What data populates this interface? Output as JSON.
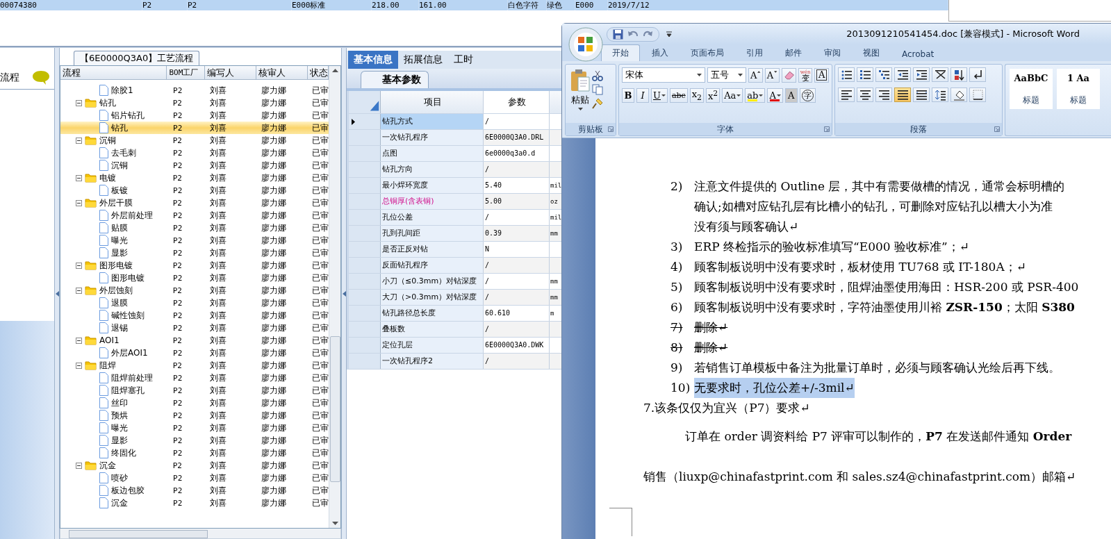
{
  "order_row": {
    "selected": true,
    "cells": [
      "00074380",
      "P2",
      "P2",
      "E000标准",
      "218.00",
      "161.00",
      "白色字符",
      "绿色",
      "E000",
      "2019/7/12"
    ]
  },
  "sidebar": {
    "title": "流程"
  },
  "process_panel": {
    "title": "【6E0000Q3A0】工艺流程",
    "columns": [
      "流程",
      "BOM工厂",
      "编写人",
      "核审人",
      "状态"
    ],
    "items": [
      {
        "name": "除胶1",
        "bom": "P2",
        "writer": "刘喜",
        "reviewer": "廖力娜",
        "status": "已审",
        "selected": false
      },
      {
        "name": "钻孔",
        "bom": "P2",
        "writer": "刘喜",
        "reviewer": "廖力娜",
        "status": "已审",
        "selected": false,
        "expanded": true,
        "children": [
          {
            "name": "铝片钻孔",
            "bom": "P2",
            "writer": "刘喜",
            "reviewer": "廖力娜",
            "status": "已审",
            "selected": false
          },
          {
            "name": "钻孔",
            "bom": "P2",
            "writer": "刘喜",
            "reviewer": "廖力娜",
            "status": "已审",
            "selected": true
          }
        ]
      },
      {
        "name": "沉铜",
        "bom": "P2",
        "writer": "刘喜",
        "reviewer": "廖力娜",
        "status": "已审",
        "selected": false,
        "expanded": true,
        "children": [
          {
            "name": "去毛刺",
            "bom": "P2",
            "writer": "刘喜",
            "reviewer": "廖力娜",
            "status": "已审",
            "selected": false
          },
          {
            "name": "沉铜",
            "bom": "P2",
            "writer": "刘喜",
            "reviewer": "廖力娜",
            "status": "已审",
            "selected": false
          }
        ]
      },
      {
        "name": "电镀",
        "bom": "P2",
        "writer": "刘喜",
        "reviewer": "廖力娜",
        "status": "已审",
        "selected": false,
        "expanded": true,
        "children": [
          {
            "name": "板镀",
            "bom": "P2",
            "writer": "刘喜",
            "reviewer": "廖力娜",
            "status": "已审",
            "selected": false
          }
        ]
      },
      {
        "name": "外层干膜",
        "bom": "P2",
        "writer": "刘喜",
        "reviewer": "廖力娜",
        "status": "已审",
        "selected": false,
        "expanded": true,
        "children": [
          {
            "name": "外层前处理",
            "bom": "P2",
            "writer": "刘喜",
            "reviewer": "廖力娜",
            "status": "已审",
            "selected": false
          },
          {
            "name": "贴膜",
            "bom": "P2",
            "writer": "刘喜",
            "reviewer": "廖力娜",
            "status": "已审",
            "selected": false
          },
          {
            "name": "曝光",
            "bom": "P2",
            "writer": "刘喜",
            "reviewer": "廖力娜",
            "status": "已审",
            "selected": false
          },
          {
            "name": "显影",
            "bom": "P2",
            "writer": "刘喜",
            "reviewer": "廖力娜",
            "status": "已审",
            "selected": false
          }
        ]
      },
      {
        "name": "图形电镀",
        "bom": "P2",
        "writer": "刘喜",
        "reviewer": "廖力娜",
        "status": "已审",
        "selected": false,
        "expanded": true,
        "children": [
          {
            "name": "图形电镀",
            "bom": "P2",
            "writer": "刘喜",
            "reviewer": "廖力娜",
            "status": "已审",
            "selected": false
          }
        ]
      },
      {
        "name": "外层蚀刻",
        "bom": "P2",
        "writer": "刘喜",
        "reviewer": "廖力娜",
        "status": "已审",
        "selected": false,
        "expanded": true,
        "children": [
          {
            "name": "退膜",
            "bom": "P2",
            "writer": "刘喜",
            "reviewer": "廖力娜",
            "status": "已审",
            "selected": false
          },
          {
            "name": "碱性蚀刻",
            "bom": "P2",
            "writer": "刘喜",
            "reviewer": "廖力娜",
            "status": "已审",
            "selected": false
          },
          {
            "name": "退锡",
            "bom": "P2",
            "writer": "刘喜",
            "reviewer": "廖力娜",
            "status": "已审",
            "selected": false
          }
        ]
      },
      {
        "name": "AOI1",
        "bom": "P2",
        "writer": "刘喜",
        "reviewer": "廖力娜",
        "status": "已审",
        "selected": false,
        "expanded": true,
        "children": [
          {
            "name": "外层AOI1",
            "bom": "P2",
            "writer": "刘喜",
            "reviewer": "廖力娜",
            "status": "已审",
            "selected": false
          }
        ]
      },
      {
        "name": "阻焊",
        "bom": "P2",
        "writer": "刘喜",
        "reviewer": "廖力娜",
        "status": "已审",
        "selected": false,
        "expanded": true,
        "children": [
          {
            "name": "阻焊前处理",
            "bom": "P2",
            "writer": "刘喜",
            "reviewer": "廖力娜",
            "status": "已审",
            "selected": false
          },
          {
            "name": "阻焊塞孔",
            "bom": "P2",
            "writer": "刘喜",
            "reviewer": "廖力娜",
            "status": "已审",
            "selected": false
          },
          {
            "name": "丝印",
            "bom": "P2",
            "writer": "刘喜",
            "reviewer": "廖力娜",
            "status": "已审",
            "selected": false
          },
          {
            "name": "预烘",
            "bom": "P2",
            "writer": "刘喜",
            "reviewer": "廖力娜",
            "status": "已审",
            "selected": false
          },
          {
            "name": "曝光",
            "bom": "P2",
            "writer": "刘喜",
            "reviewer": "廖力娜",
            "status": "已审",
            "selected": false
          },
          {
            "name": "显影",
            "bom": "P2",
            "writer": "刘喜",
            "reviewer": "廖力娜",
            "status": "已审",
            "selected": false
          },
          {
            "name": "终固化",
            "bom": "P2",
            "writer": "刘喜",
            "reviewer": "廖力娜",
            "status": "已审",
            "selected": false
          }
        ]
      },
      {
        "name": "沉金",
        "bom": "P2",
        "writer": "刘喜",
        "reviewer": "廖力娜",
        "status": "已审",
        "selected": false,
        "expanded": true,
        "children": [
          {
            "name": "喷砂",
            "bom": "P2",
            "writer": "刘喜",
            "reviewer": "廖力娜",
            "status": "已审",
            "selected": false
          },
          {
            "name": "板边包胶",
            "bom": "P2",
            "writer": "刘喜",
            "reviewer": "廖力娜",
            "status": "已审",
            "selected": false
          },
          {
            "name": "沉金",
            "bom": "P2",
            "writer": "刘喜",
            "reviewer": "廖力娜",
            "status": "已审",
            "selected": false
          }
        ]
      }
    ]
  },
  "info_panel": {
    "tabs": [
      {
        "label": "基本信息",
        "selected": true
      },
      {
        "label": "拓展信息",
        "selected": false
      },
      {
        "label": "工时",
        "selected": false
      }
    ],
    "subtab": "基本参数",
    "columns": [
      "项目",
      "参数"
    ],
    "rows": [
      {
        "item": "钻孔方式",
        "value": "/",
        "selected": true,
        "emphasized": false
      },
      {
        "item": "一次钻孔程序",
        "value": "6E0000Q3A0.DRL",
        "selected": false,
        "emphasized": false
      },
      {
        "item": "点图",
        "value": "6e0000q3a0.d",
        "selected": false,
        "emphasized": false
      },
      {
        "item": "钻孔方向",
        "value": "/",
        "selected": false,
        "emphasized": false
      },
      {
        "item": "最小焊环宽度",
        "value": "5.40",
        "unit": "mil",
        "selected": false,
        "emphasized": false
      },
      {
        "item": "总铜厚(含表铜)",
        "value": "5.00",
        "unit": "oz",
        "selected": false,
        "emphasized": true
      },
      {
        "item": "孔位公差",
        "value": "/",
        "unit": "mil",
        "selected": false,
        "emphasized": false
      },
      {
        "item": "孔到孔间距",
        "value": "0.39",
        "unit": "mm",
        "selected": false,
        "emphasized": false
      },
      {
        "item": "是否正反对钻",
        "value": "N",
        "selected": false,
        "emphasized": false
      },
      {
        "item": "反面钻孔程序",
        "value": "/",
        "selected": false,
        "emphasized": false
      },
      {
        "item": "小刀（≤0.3mm）对钻深度",
        "value": "/",
        "unit": "mm",
        "selected": false,
        "emphasized": false
      },
      {
        "item": "大刀（>0.3mm）对钻深度",
        "value": "/",
        "unit": "mm",
        "selected": false,
        "emphasized": false
      },
      {
        "item": "钻孔路径总长度",
        "value": "60.610",
        "unit": "m",
        "selected": false,
        "emphasized": false
      },
      {
        "item": "叠板数",
        "value": "/",
        "selected": false,
        "emphasized": false
      },
      {
        "item": "定位孔层",
        "value": "6E0000Q3A0.DWK",
        "selected": false,
        "emphasized": false
      },
      {
        "item": "一次钻孔程序2",
        "value": "/",
        "selected": false,
        "emphasized": false
      }
    ]
  },
  "word": {
    "title": "2013091210541454.doc [兼容模式] - Microsoft Word",
    "tabs": [
      {
        "label": "开始",
        "selected": true
      },
      {
        "label": "插入",
        "selected": false
      },
      {
        "label": "页面布局",
        "selected": false
      },
      {
        "label": "引用",
        "selected": false
      },
      {
        "label": "邮件",
        "selected": false
      },
      {
        "label": "审阅",
        "selected": false
      },
      {
        "label": "视图",
        "selected": false
      },
      {
        "label": "Acrobat",
        "selected": false
      }
    ],
    "clipboard": {
      "paste": "粘贴",
      "label": "剪贴板"
    },
    "font": {
      "name": "宋体",
      "size": "五号",
      "label": "字体",
      "buttons": [
        {
          "kind": "grow",
          "label": "A"
        },
        {
          "kind": "shrink",
          "label": "A"
        },
        {
          "kind": "clear"
        },
        {
          "kind": "phonetic",
          "top": "wén",
          "label": "变"
        },
        {
          "kind": "border",
          "label": "A"
        },
        {
          "kind": "bold",
          "label": "B"
        },
        {
          "kind": "italic",
          "label": "I"
        },
        {
          "kind": "underline",
          "label": "U"
        },
        {
          "kind": "strike",
          "label": "abc"
        },
        {
          "kind": "sub",
          "label": "x$_{2}$"
        },
        {
          "kind": "super",
          "label": "x$^{2}$"
        },
        {
          "kind": "case",
          "label": "Aa"
        },
        {
          "kind": "highlight",
          "label": "ab"
        },
        {
          "kind": "color",
          "label": "A"
        },
        {
          "kind": "shade",
          "label": "A"
        },
        {
          "kind": "enclose",
          "label": "字"
        }
      ]
    },
    "paragraph": {
      "label": "段落",
      "buttons": [
        {
          "kind": "bullets",
          "selected": false
        },
        {
          "kind": "numbering",
          "selected": false
        },
        {
          "kind": "multilevel",
          "selected": false
        },
        {
          "kind": "outdent",
          "selected": false
        },
        {
          "kind": "indent",
          "selected": false
        },
        {
          "kind": "asian",
          "selected": false
        },
        {
          "kind": "sort",
          "selected": false
        },
        {
          "kind": "marks",
          "selected": false
        },
        {
          "kind": "left",
          "selected": false
        },
        {
          "kind": "center",
          "selected": false
        },
        {
          "kind": "right",
          "selected": false
        },
        {
          "kind": "justify",
          "selected": true
        },
        {
          "kind": "distribute",
          "selected": false
        },
        {
          "kind": "spacing",
          "selected": false
        },
        {
          "kind": "shading",
          "selected": false
        },
        {
          "kind": "borders",
          "selected": false
        }
      ]
    },
    "styles": [
      {
        "sample": "AaBbC",
        "label": "标题"
      },
      {
        "sample": "1 Aa",
        "label": "标题"
      }
    ],
    "paragraphs": [
      {
        "kind": "numbered",
        "number": "2)",
        "lines": [
          "注意文件提供的 Outline 层，其中有需要做槽的情况，通常会标明槽的",
          "确认;如槽对应钻孔层有比槽小的钻孔，可删除对应钻孔以槽大小为准",
          "没有须与顾客确认↵"
        ],
        "struck": false,
        "selected": false
      },
      {
        "kind": "numbered",
        "number": "3)",
        "lines": [
          "ERP 终检指示的验收标准填写“E000 验收标准”；↵"
        ],
        "struck": false,
        "selected": false
      },
      {
        "kind": "numbered",
        "number": "4)",
        "lines": [
          "顾客制板说明中没有要求时，板材使用 TU768 或 IT-180A；↵"
        ],
        "struck": false,
        "selected": false
      },
      {
        "kind": "numbered",
        "number": "5)",
        "lines": [
          "顾客制板说明中没有要求时，阻焊油墨使用海田：HSR-200 或 PSR-400"
        ],
        "struck": false,
        "selected": false
      },
      {
        "kind": "numbered",
        "number": "6)",
        "lines": [
          "顾客制板说明中没有要求时，字符油墨使用川裕 **ZSR-150**；太阳 **S380**"
        ],
        "struck": false,
        "selected": false
      },
      {
        "kind": "numbered",
        "number": "7)",
        "lines": [
          "删除↵"
        ],
        "struck": true,
        "selected": false
      },
      {
        "kind": "numbered",
        "number": "8)",
        "lines": [
          "删除↵"
        ],
        "struck": true,
        "selected": false
      },
      {
        "kind": "numbered",
        "number": "9)",
        "lines": [
          "若销售订单模板中备注为批量订单时，必须与顾客确认光绘后再下线。"
        ],
        "struck": false,
        "selected": false
      },
      {
        "kind": "numbered",
        "number": "10)",
        "lines": [
          "无要求时，孔位公差+/-3mil↵"
        ],
        "struck": false,
        "selected": true
      },
      {
        "kind": "heading",
        "lines": [
          "7.该条仅仅为宜兴（P7）要求↵"
        ]
      },
      {
        "kind": "body",
        "lines": [
          "订单在 order 调资料给 P7 评审可以制作的，**P7** 在发送邮件通知 **Order**"
        ]
      },
      {
        "kind": "plain",
        "lines": [
          "销售（liuxp@chinafastprint.com 和 sales.sz4@chinafastprint.com）邮箱↵"
        ]
      }
    ]
  }
}
